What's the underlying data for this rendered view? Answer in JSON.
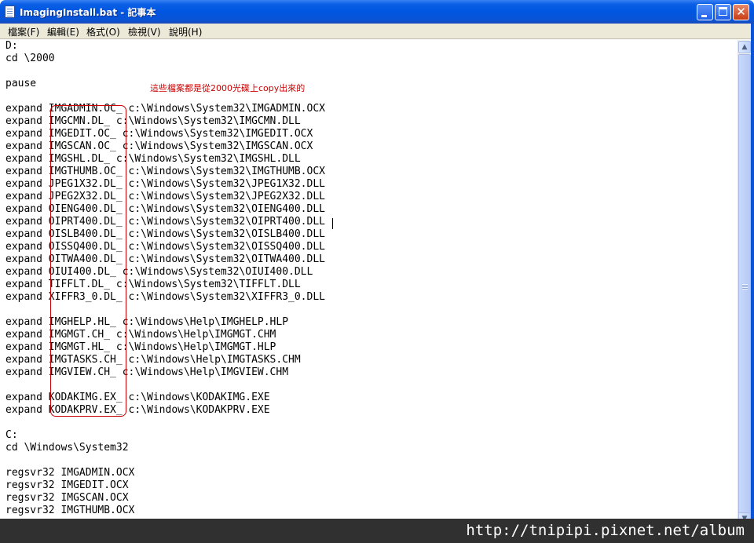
{
  "window": {
    "title": "ImagingInstall.bat - 記事本"
  },
  "menu": [
    "檔案(F)",
    "編輯(E)",
    "格式(O)",
    "檢視(V)",
    "說明(H)"
  ],
  "editor": {
    "content": "D:\ncd \\2000\n\npause\n\nexpand IMGADMIN.OC_ c:\\Windows\\System32\\IMGADMIN.OCX\nexpand IMGCMN.DL_ c:\\Windows\\System32\\IMGCMN.DLL\nexpand IMGEDIT.OC_ c:\\Windows\\System32\\IMGEDIT.OCX\nexpand IMGSCAN.OC_ c:\\Windows\\System32\\IMGSCAN.OCX\nexpand IMGSHL.DL_ c:\\Windows\\System32\\IMGSHL.DLL\nexpand IMGTHUMB.OC_ c:\\Windows\\System32\\IMGTHUMB.OCX\nexpand JPEG1X32.DL_ c:\\Windows\\System32\\JPEG1X32.DLL\nexpand JPEG2X32.DL_ c:\\Windows\\System32\\JPEG2X32.DLL\nexpand OIENG400.DL_ c:\\Windows\\System32\\OIENG400.DLL\nexpand OIPRT400.DL_ c:\\Windows\\System32\\OIPRT400.DLL\nexpand OISLB400.DL_ c:\\Windows\\System32\\OISLB400.DLL\nexpand OISSQ400.DL_ c:\\Windows\\System32\\OISSQ400.DLL\nexpand OITWA400.DL_ c:\\Windows\\System32\\OITWA400.DLL\nexpand OIUI400.DL_ c:\\Windows\\System32\\OIUI400.DLL\nexpand TIFFLT.DL_ c:\\Windows\\System32\\TIFFLT.DLL\nexpand XIFFR3_0.DL_ c:\\Windows\\System32\\XIFFR3_0.DLL\n\nexpand IMGHELP.HL_ c:\\Windows\\Help\\IMGHELP.HLP\nexpand IMGMGT.CH_ c:\\Windows\\Help\\IMGMGT.CHM\nexpand IMGMGT.HL_ c:\\Windows\\Help\\IMGMGT.HLP\nexpand IMGTASKS.CH_ c:\\Windows\\Help\\IMGTASKS.CHM\nexpand IMGVIEW.CH_ c:\\Windows\\Help\\IMGVIEW.CHM\n\nexpand KODAKIMG.EX_ c:\\Windows\\KODAKIMG.EXE\nexpand KODAKPRV.EX_ c:\\Windows\\KODAKPRV.EXE\n\nC:\ncd \\Windows\\System32\n\nregsvr32 IMGADMIN.OCX\nregsvr32 IMGEDIT.OCX\nregsvr32 IMGSCAN.OCX\nregsvr32 IMGTHUMB.OCX"
  },
  "annotation": {
    "text": "這些檔案都是從2000光碟上copy出來的",
    "color": "#cc0000"
  },
  "watermark": {
    "text": "http://tnipipi.pixnet.net/album"
  },
  "colors": {
    "titlebar": "#0056e0",
    "menubar": "#ece9d8",
    "highlight": "#cc0000"
  }
}
